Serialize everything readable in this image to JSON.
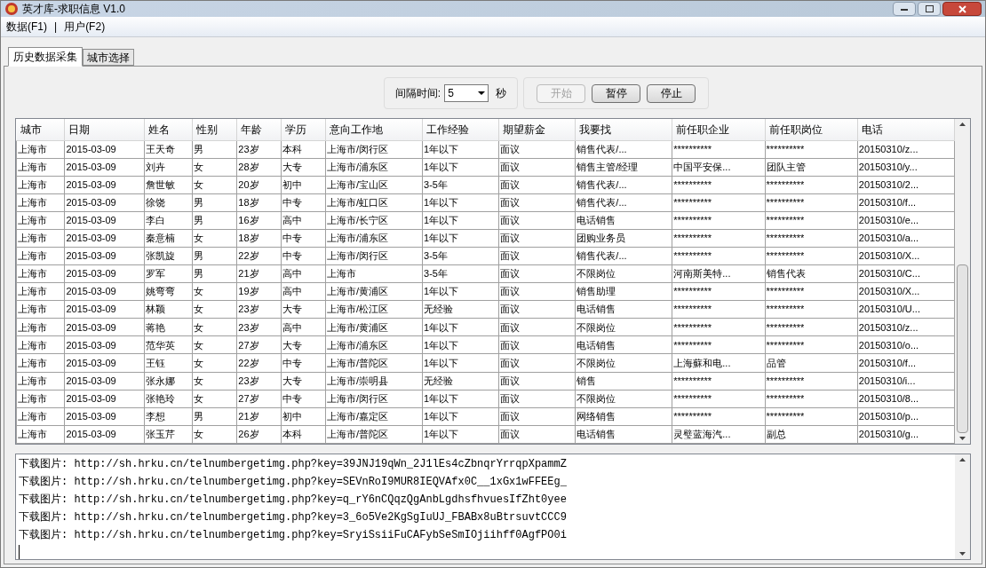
{
  "window": {
    "title": "英才库-求职信息 V1.0"
  },
  "menu": [
    {
      "label": "数据(F1)"
    },
    {
      "label": "|"
    },
    {
      "label": "用户(F2)"
    }
  ],
  "tabs": [
    {
      "label": "历史数据采集",
      "selected": true
    },
    {
      "label": "城市选择",
      "selected": false
    }
  ],
  "interval": {
    "label": "间隔时间:",
    "value": "5",
    "unit": "秒"
  },
  "buttons": [
    {
      "label": "开始",
      "disabled": true
    },
    {
      "label": "暂停",
      "disabled": false
    },
    {
      "label": "停止",
      "disabled": false
    }
  ],
  "table": {
    "columns": [
      "城市",
      "日期",
      "姓名",
      "性别",
      "年龄",
      "学历",
      "意向工作地",
      "工作经验",
      "期望薪金",
      "我要找",
      "前任职企业",
      "前任职岗位",
      "电话"
    ],
    "rows": [
      [
        "上海市",
        "2015-03-09",
        "王天奇",
        "男",
        "23岁",
        "本科",
        "上海市/闵行区",
        "1年以下",
        "面议",
        "销售代表/...",
        "**********",
        "**********",
        "20150310/z..."
      ],
      [
        "上海市",
        "2015-03-09",
        "刘卉",
        "女",
        "28岁",
        "大专",
        "上海市/浦东区",
        "1年以下",
        "面议",
        "销售主管/经理",
        "中国平安保...",
        "团队主管",
        "20150310/y..."
      ],
      [
        "上海市",
        "2015-03-09",
        "詹世敏",
        "女",
        "20岁",
        "初中",
        "上海市/宝山区",
        "3-5年",
        "面议",
        "销售代表/...",
        "**********",
        "**********",
        "20150310/2..."
      ],
      [
        "上海市",
        "2015-03-09",
        "徐饶",
        "男",
        "18岁",
        "中专",
        "上海市/虹口区",
        "1年以下",
        "面议",
        "销售代表/...",
        "**********",
        "**********",
        "20150310/f..."
      ],
      [
        "上海市",
        "2015-03-09",
        "李白",
        "男",
        "16岁",
        "高中",
        "上海市/长宁区",
        "1年以下",
        "面议",
        "电话销售",
        "**********",
        "**********",
        "20150310/e..."
      ],
      [
        "上海市",
        "2015-03-09",
        "秦意楠",
        "女",
        "18岁",
        "中专",
        "上海市/浦东区",
        "1年以下",
        "面议",
        "团购业务员",
        "**********",
        "**********",
        "20150310/a..."
      ],
      [
        "上海市",
        "2015-03-09",
        "张凯旋",
        "男",
        "22岁",
        "中专",
        "上海市/闵行区",
        "3-5年",
        "面议",
        "销售代表/...",
        "**********",
        "**********",
        "20150310/X..."
      ],
      [
        "上海市",
        "2015-03-09",
        "罗军",
        "男",
        "21岁",
        "高中",
        "上海市",
        "3-5年",
        "面议",
        "不限岗位",
        "河南斯美特...",
        "销售代表",
        "20150310/C..."
      ],
      [
        "上海市",
        "2015-03-09",
        "姚弯弯",
        "女",
        "19岁",
        "高中",
        "上海市/黄浦区",
        "1年以下",
        "面议",
        "销售助理",
        "**********",
        "**********",
        "20150310/X..."
      ],
      [
        "上海市",
        "2015-03-09",
        "林颖",
        "女",
        "23岁",
        "大专",
        "上海市/松江区",
        "无经验",
        "面议",
        "电话销售",
        "**********",
        "**********",
        "20150310/U..."
      ],
      [
        "上海市",
        "2015-03-09",
        "蒋艳",
        "女",
        "23岁",
        "高中",
        "上海市/黄浦区",
        "1年以下",
        "面议",
        "不限岗位",
        "**********",
        "**********",
        "20150310/z..."
      ],
      [
        "上海市",
        "2015-03-09",
        "范华英",
        "女",
        "27岁",
        "大专",
        "上海市/浦东区",
        "1年以下",
        "面议",
        "电话销售",
        "**********",
        "**********",
        "20150310/o..."
      ],
      [
        "上海市",
        "2015-03-09",
        "王钰",
        "女",
        "22岁",
        "中专",
        "上海市/普陀区",
        "1年以下",
        "面议",
        "不限岗位",
        "上海蘇和电...",
        "品管",
        "20150310/f..."
      ],
      [
        "上海市",
        "2015-03-09",
        "张永娜",
        "女",
        "23岁",
        "大专",
        "上海市/崇明县",
        "无经验",
        "面议",
        "销售",
        "**********",
        "**********",
        "20150310/i..."
      ],
      [
        "上海市",
        "2015-03-09",
        "张艳玲",
        "女",
        "27岁",
        "中专",
        "上海市/闵行区",
        "1年以下",
        "面议",
        "不限岗位",
        "**********",
        "**********",
        "20150310/8..."
      ],
      [
        "上海市",
        "2015-03-09",
        "李想",
        "男",
        "21岁",
        "初中",
        "上海市/嘉定区",
        "1年以下",
        "面议",
        "网络销售",
        "**********",
        "**********",
        "20150310/p..."
      ],
      [
        "上海市",
        "2015-03-09",
        "张玉芹",
        "女",
        "26岁",
        "本科",
        "上海市/普陀区",
        "1年以下",
        "面议",
        "电话销售",
        "灵璧蓝海汽...",
        "副总",
        "20150310/g..."
      ]
    ]
  },
  "log": [
    "下载图片: http://sh.hrku.cn/telnumbergetimg.php?key=39JNJ19qWn_2J1lEs4cZbnqrYrrqpXpammZ",
    "下载图片: http://sh.hrku.cn/telnumbergetimg.php?key=SEVnRoI9MUR8IEQVAfx0C__1xGx1wFFEEg_",
    "下载图片: http://sh.hrku.cn/telnumbergetimg.php?key=q_rY6nCQqzQgAnbLgdhsfhvuesIfZht0yee",
    "下载图片: http://sh.hrku.cn/telnumbergetimg.php?key=3_6o5Ve2KgSgIuUJ_FBABx8uBtrsuvtCCC9",
    "下载图片: http://sh.hrku.cn/telnumbergetimg.php?key=SryiSsiiFuCAFybSeSmIOjiihff0AgfPO0i"
  ]
}
